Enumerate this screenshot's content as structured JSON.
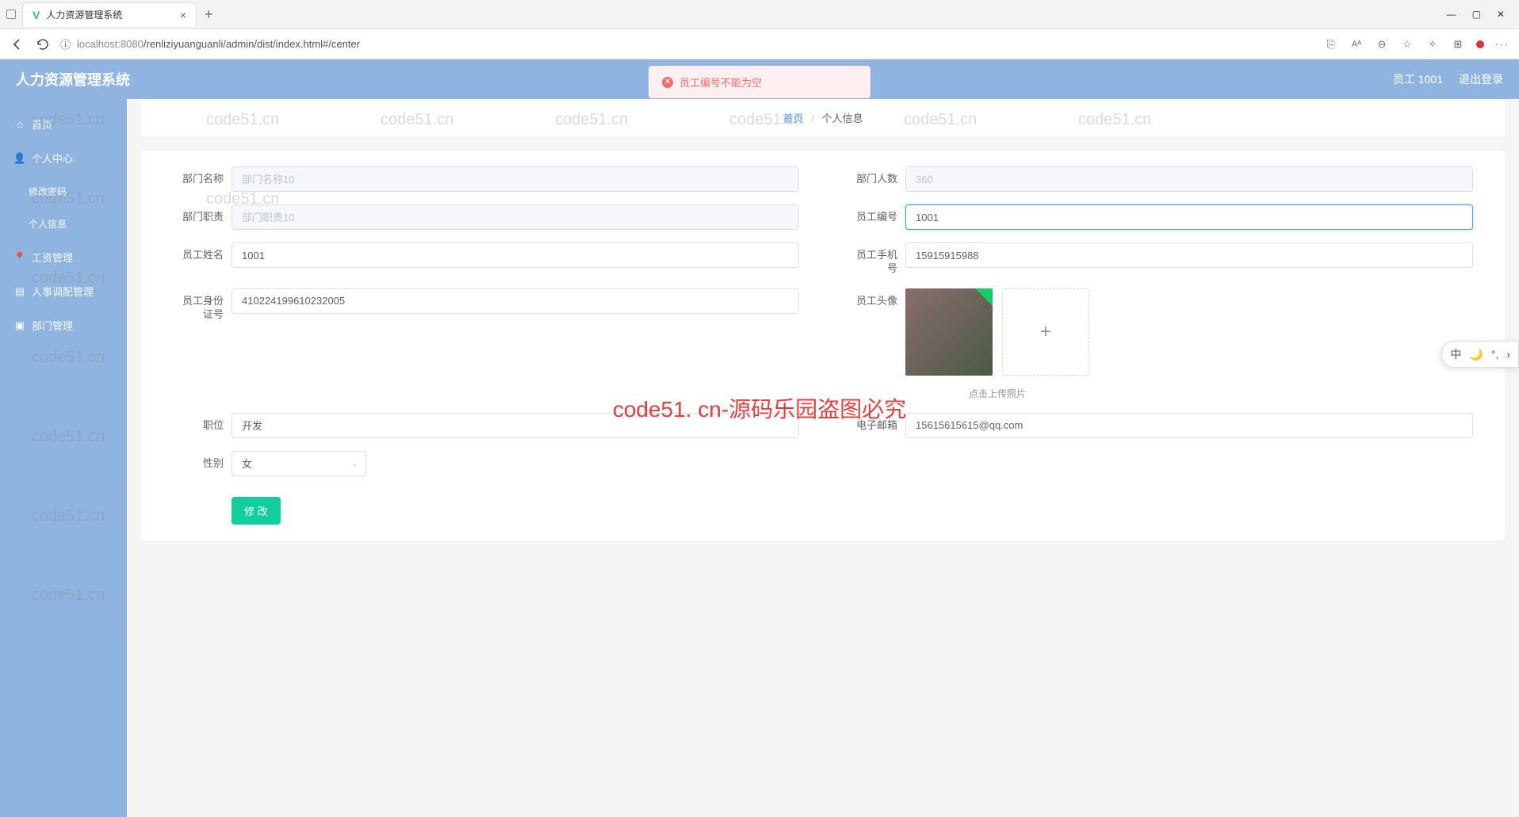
{
  "browser": {
    "tab_title": "人力资源管理系统",
    "url_host": "localhost",
    "url_port": ":8080",
    "url_path": "/renliziyuanguanli/admin/dist/index.html#/center"
  },
  "header": {
    "app_title": "人力资源管理系统",
    "alert_text": "员工编号不能为空",
    "user_label": "员工 1001",
    "logout": "退出登录"
  },
  "sidebar": {
    "items": [
      {
        "label": "首页",
        "icon": "home"
      },
      {
        "label": "个人中心",
        "icon": "user"
      },
      {
        "label": "修改密码",
        "sub": true
      },
      {
        "label": "个人信息",
        "sub": true
      },
      {
        "label": "工资管理",
        "icon": "pin"
      },
      {
        "label": "人事调配管理",
        "icon": "doc"
      },
      {
        "label": "部门管理",
        "icon": "folder"
      }
    ]
  },
  "breadcrumb": {
    "home": "首页",
    "current": "个人信息"
  },
  "form": {
    "left": {
      "dept_name": {
        "label": "部门名称",
        "placeholder": "部门名称10",
        "value": ""
      },
      "dept_duty": {
        "label": "部门职责",
        "placeholder": "部门职责10",
        "value": ""
      },
      "emp_name": {
        "label": "员工姓名",
        "value": "1001"
      },
      "emp_idcard": {
        "label": "员工身份证号",
        "value": "410224199610232005"
      },
      "position": {
        "label": "职位",
        "value": "开发"
      },
      "gender": {
        "label": "性别",
        "value": "女"
      }
    },
    "right": {
      "dept_count": {
        "label": "部门人数",
        "placeholder": "360",
        "value": ""
      },
      "emp_no": {
        "label": "员工编号",
        "value": "1001"
      },
      "emp_phone": {
        "label": "员工手机号",
        "value": "15915915988"
      },
      "avatar": {
        "label": "员工头像",
        "tip": "点击上传照片"
      },
      "email": {
        "label": "电子邮箱",
        "value": "15615615615@qq.com"
      }
    },
    "submit": "修 改"
  },
  "watermark": {
    "center": "code51. cn-源码乐园盗图必究",
    "tile": "code51.cn"
  },
  "ime": {
    "mode": "中"
  }
}
